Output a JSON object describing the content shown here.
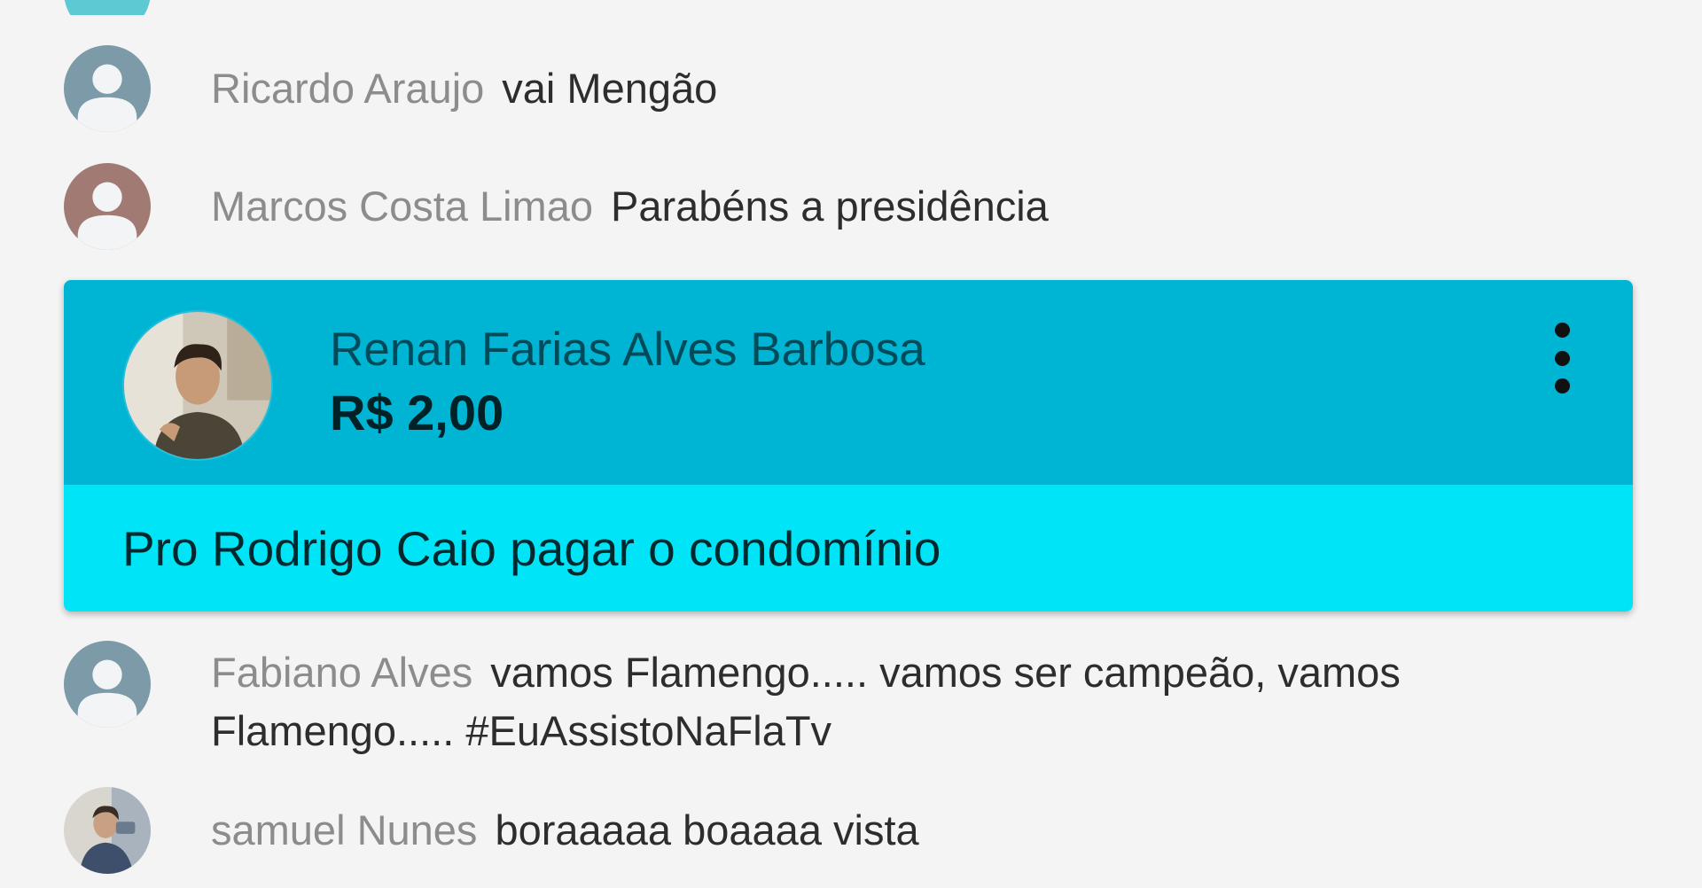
{
  "messages": [
    {
      "author": "Ricardo Araujo",
      "text": "vai Mengão",
      "avatar": "default-avatar",
      "avatar_color": "#7d9aa8"
    },
    {
      "author": "Marcos Costa Limao",
      "text": "Parabéns a presidência",
      "avatar": "default-avatar",
      "avatar_color": "#a17a73"
    },
    {
      "author": "Fabiano Alves",
      "text": "vamos Flamengo..... vamos ser campeão, vamos Flamengo..... #EuAssistoNaFlaTv",
      "avatar": "default-avatar",
      "avatar_color": "#7d9aa8"
    },
    {
      "author": "samuel Nunes",
      "text": "boraaaaa boaaaa vista",
      "avatar": "user-photo",
      "avatar_color": "#9aa8b5"
    }
  ],
  "super_chat": {
    "author": "Renan Farias Alves Barbosa",
    "amount": "R$ 2,00",
    "message": "Pro Rodrigo Caio pagar o condomínio",
    "menu_icon": "more-vertical-icon",
    "header_color": "#00b4d4",
    "body_color": "#00e4f8"
  },
  "partial_top_avatar_color": "#5cc9d3"
}
